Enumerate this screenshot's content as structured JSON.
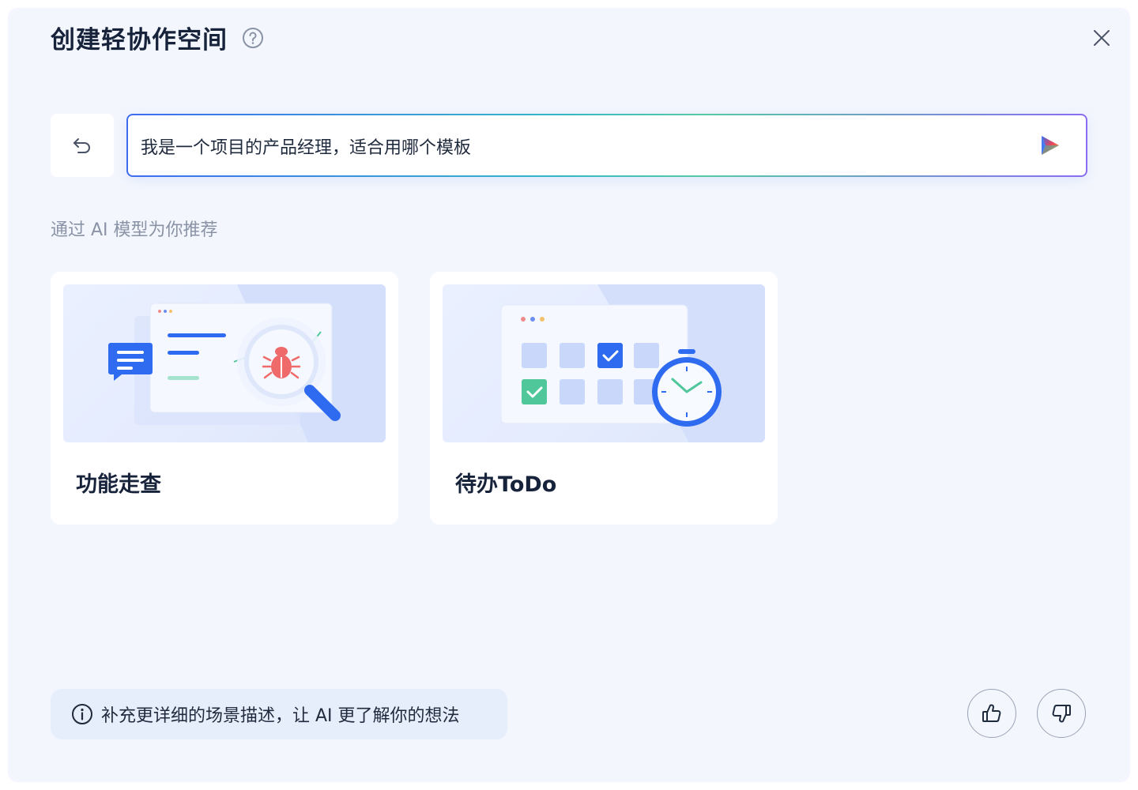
{
  "dialog": {
    "title": "创建轻协作空间",
    "prompt": {
      "value": "我是一个项目的产品经理，适合用哪个模板",
      "placeholder": ""
    },
    "recommend_label": "通过 AI 模型为你推荐",
    "cards": [
      {
        "title": "功能走查",
        "illustration": "bug-search-illustration"
      },
      {
        "title": "待办ToDo",
        "illustration": "todo-clock-illustration"
      }
    ],
    "tip": {
      "icon": "info-icon",
      "text": "补充更详细的场景描述，让 AI 更了解你的想法"
    },
    "icons": {
      "help": "question-circle-icon",
      "close": "close-icon",
      "back": "undo-arrow-icon",
      "send": "send-arrow-icon",
      "like": "thumbs-up-icon",
      "dislike": "thumbs-down-icon"
    }
  },
  "colors": {
    "dialog_bg": "#f3f6fd",
    "title": "#17233b",
    "muted_text": "#8a93a6",
    "accent_blue": "#2f6bf0",
    "accent_green": "#4fc79a",
    "tip_bg": "#e6edfb"
  }
}
